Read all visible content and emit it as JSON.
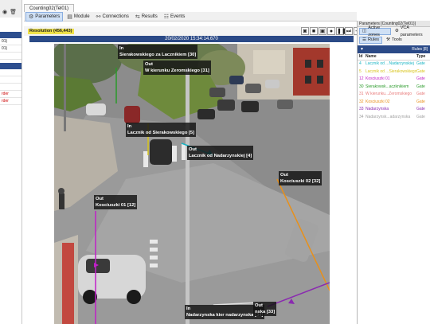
{
  "left_panel": {
    "row_labels": [
      "01)",
      "01)",
      "rder",
      "rder"
    ]
  },
  "window_tab": "Counting02(Tel01)",
  "toolbar": {
    "items": [
      {
        "label": "Parameters",
        "icon": "gear-icon",
        "active": true
      },
      {
        "label": "Module",
        "icon": "module-icon",
        "active": false
      },
      {
        "label": "Connections",
        "icon": "link-icon",
        "active": false
      },
      {
        "label": "Results",
        "icon": "results-icon",
        "active": false
      },
      {
        "label": "Events",
        "icon": "events-icon",
        "active": false
      }
    ]
  },
  "resolution_label": "Resolution (456,443)",
  "timestamp": "20/02/2020 15:34:14.670",
  "playback_icons": [
    "camera-icon",
    "stop-icon",
    "frame-icon",
    "record-icon",
    "pause-icon",
    "step-forward-icon",
    "skip-end-icon"
  ],
  "zones": [
    {
      "lines": [
        "In",
        "Sierakowskiego za Lacznikiem [30]"
      ]
    },
    {
      "lines": [
        "Out",
        "W kierunku Zeromskiego [31]"
      ]
    },
    {
      "lines": [
        "In",
        "Lacznik od Sierakowskiego [5]"
      ]
    },
    {
      "lines": [
        "Out",
        "Lacznik od Nadarzynskiej [4]"
      ]
    },
    {
      "lines": [
        "Out",
        "Kosciuszki 02 [32]"
      ]
    },
    {
      "lines": [
        "Out",
        "Kosciuszki 01 [12]"
      ]
    },
    {
      "lines": [
        "In",
        "Nadarzynska kier nadarzynska [34]"
      ]
    },
    {
      "lines": [
        "Out",
        "nska [33]"
      ]
    }
  ],
  "right_panel": {
    "header": "Parameters [Counting02(Tel01)]",
    "tabs1": [
      {
        "label": "Active zones",
        "active": true
      },
      {
        "label": "VCA parameters",
        "active": false
      }
    ],
    "tabs2": [
      {
        "label": "Rules",
        "active": true
      },
      {
        "label": "Tools",
        "active": false
      }
    ],
    "rules_bar": "Rules [8]",
    "col_id": "Id",
    "col_name": "Name",
    "col_type": "Type",
    "rows": [
      {
        "id": "4",
        "name": "Lacznik od ...Nadarzynskiej",
        "type": "Gate",
        "color": "#18b4c4"
      },
      {
        "id": "5",
        "name": "Lacznik od ...Sierakowskiego",
        "type": "Gate",
        "color": "#d8c41a"
      },
      {
        "id": "12",
        "name": "Kosciuszki 01",
        "type": "Gate",
        "color": "#c020c8"
      },
      {
        "id": "30",
        "name": "Sierakowsk...aczknikiem",
        "type": "Gate",
        "color": "#2a9a2a"
      },
      {
        "id": "31",
        "name": "W kierunku...Zeromskiego",
        "type": "Gate",
        "color": "#e87a7a"
      },
      {
        "id": "32",
        "name": "Kosciuszki 02",
        "type": "Gate",
        "color": "#e8901a"
      },
      {
        "id": "33",
        "name": "Nadarzynska",
        "type": "Gate",
        "color": "#8a2ab0"
      },
      {
        "id": "34",
        "name": "Nadarzynsk...adarzynska",
        "type": "Gate",
        "color": "#a0a0a0"
      }
    ]
  }
}
